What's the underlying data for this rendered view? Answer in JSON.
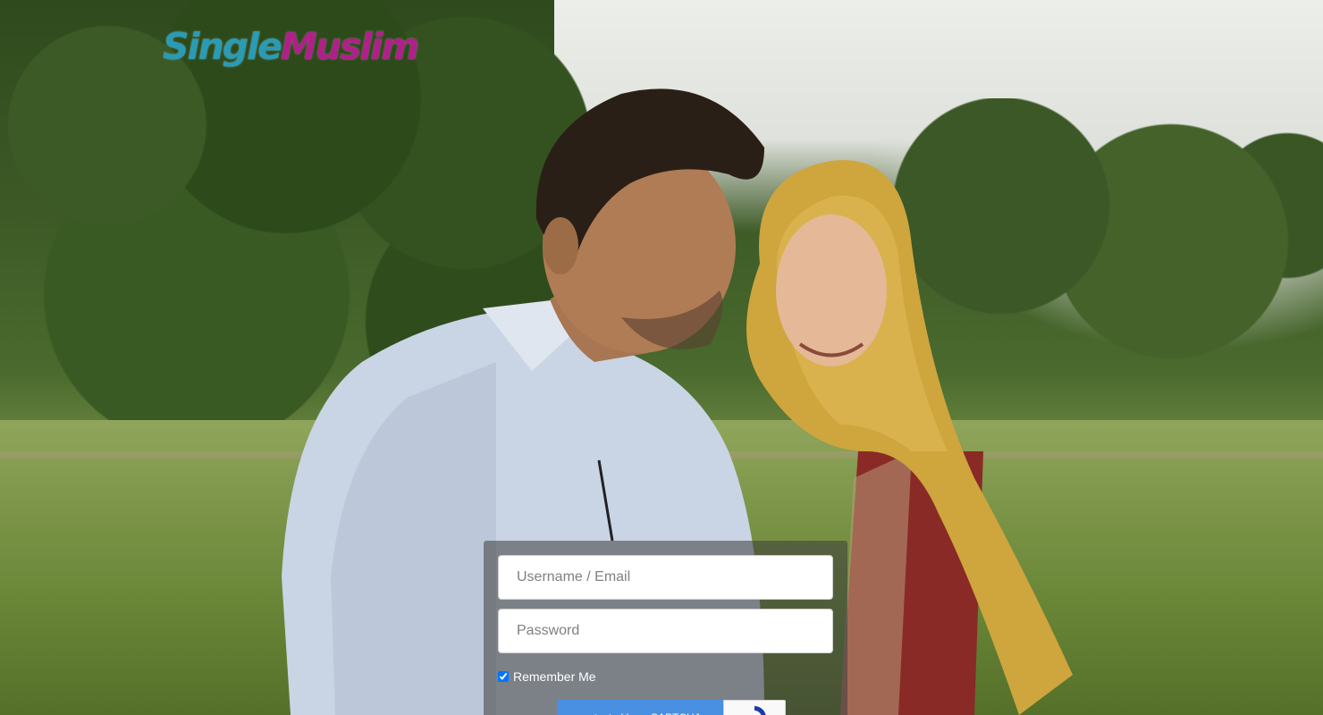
{
  "logo": {
    "part1": "Single",
    "part2": "Muslim"
  },
  "login": {
    "username_placeholder": "Username / Email",
    "password_placeholder": "Password",
    "remember_label": "Remember Me",
    "remember_checked": true,
    "recaptcha_label": "protected by reCAPTCHA"
  },
  "colors": {
    "logo_single": "#2a9bb5",
    "logo_muslim": "#b0208a",
    "recaptcha_blue": "#4a90e2"
  },
  "icons": {
    "recaptcha": "recaptcha-logo-icon"
  }
}
